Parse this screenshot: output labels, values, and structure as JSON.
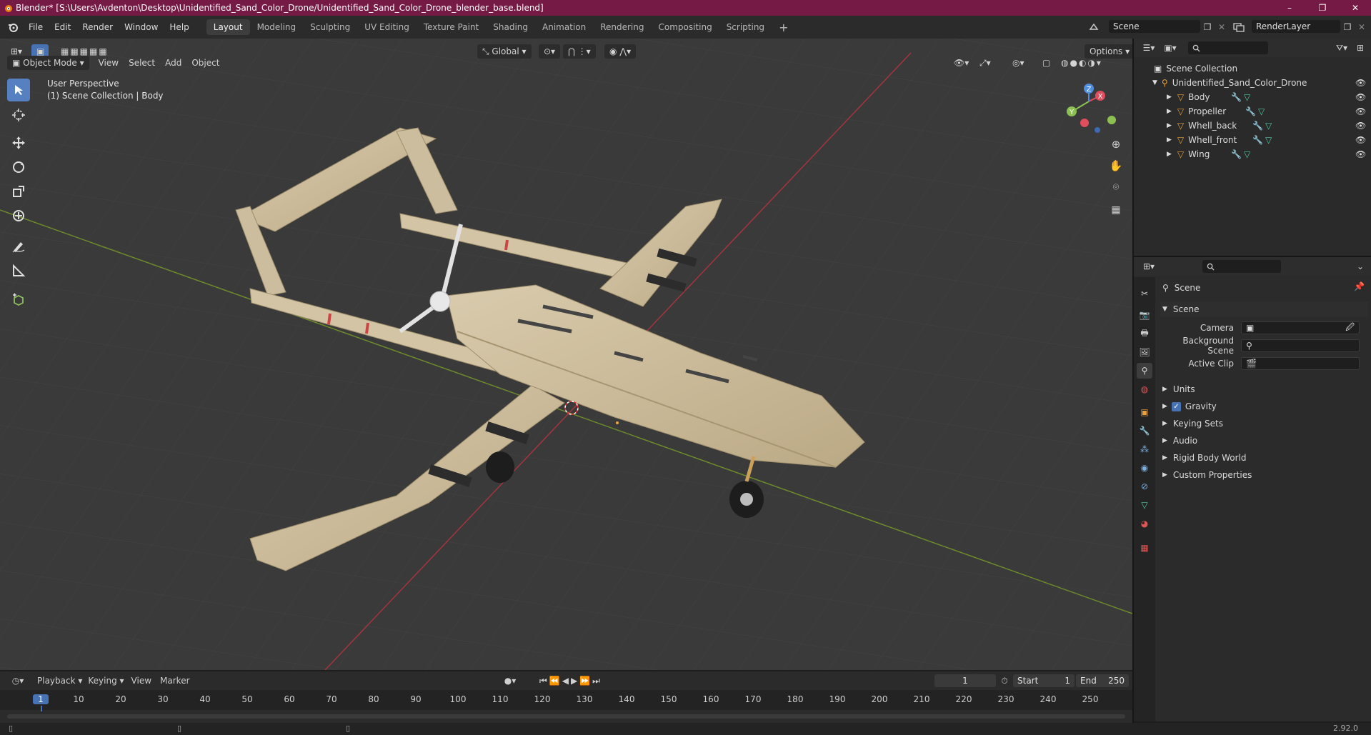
{
  "title": "Blender* [S:\\Users\\Avdenton\\Desktop\\Unidentified_Sand_Color_Drone/Unidentified_Sand_Color_Drone_blender_base.blend]",
  "window_controls": {
    "minimize": "–",
    "maximize": "❐",
    "close": "✕"
  },
  "menu": [
    "File",
    "Edit",
    "Render",
    "Window",
    "Help"
  ],
  "workspaces": [
    "Layout",
    "Modeling",
    "Sculpting",
    "UV Editing",
    "Texture Paint",
    "Shading",
    "Animation",
    "Rendering",
    "Compositing",
    "Scripting"
  ],
  "active_workspace": "Layout",
  "add_workspace": "+",
  "scene_field": "Scene",
  "render_layer_field": "RenderLayer",
  "viewport": {
    "mode": "Object Mode",
    "menus": [
      "View",
      "Select",
      "Add",
      "Object"
    ],
    "transform_orientation": "Global",
    "options": "Options",
    "overlay_line1": "User Perspective",
    "overlay_line2": "(1) Scene Collection | Body",
    "gizmo": {
      "x": "X",
      "y": "Y",
      "z": "Z"
    }
  },
  "outliner": {
    "root": "Scene Collection",
    "collection": "Unidentified_Sand_Color_Drone",
    "objects": [
      "Body",
      "Propeller",
      "Whell_back",
      "Whell_front",
      "Wing"
    ]
  },
  "properties": {
    "header": "Scene",
    "section": "Scene",
    "fields": [
      {
        "label": "Camera",
        "value": ""
      },
      {
        "label": "Background Scene",
        "value": ""
      },
      {
        "label": "Active Clip",
        "value": ""
      }
    ],
    "panels": [
      "Units",
      "Gravity",
      "Keying Sets",
      "Audio",
      "Rigid Body World",
      "Custom Properties"
    ],
    "gravity_checked": true
  },
  "timeline": {
    "menus": [
      "Playback",
      "Keying",
      "View",
      "Marker"
    ],
    "current_frame": "1",
    "start_label": "Start",
    "start": "1",
    "end_label": "End",
    "end": "250",
    "ruler": [
      "1",
      "10",
      "20",
      "30",
      "40",
      "50",
      "60",
      "70",
      "80",
      "90",
      "100",
      "110",
      "120",
      "130",
      "140",
      "150",
      "160",
      "170",
      "180",
      "190",
      "200",
      "210",
      "220",
      "230",
      "240",
      "250"
    ]
  },
  "status": {
    "version": "2.92.0"
  }
}
